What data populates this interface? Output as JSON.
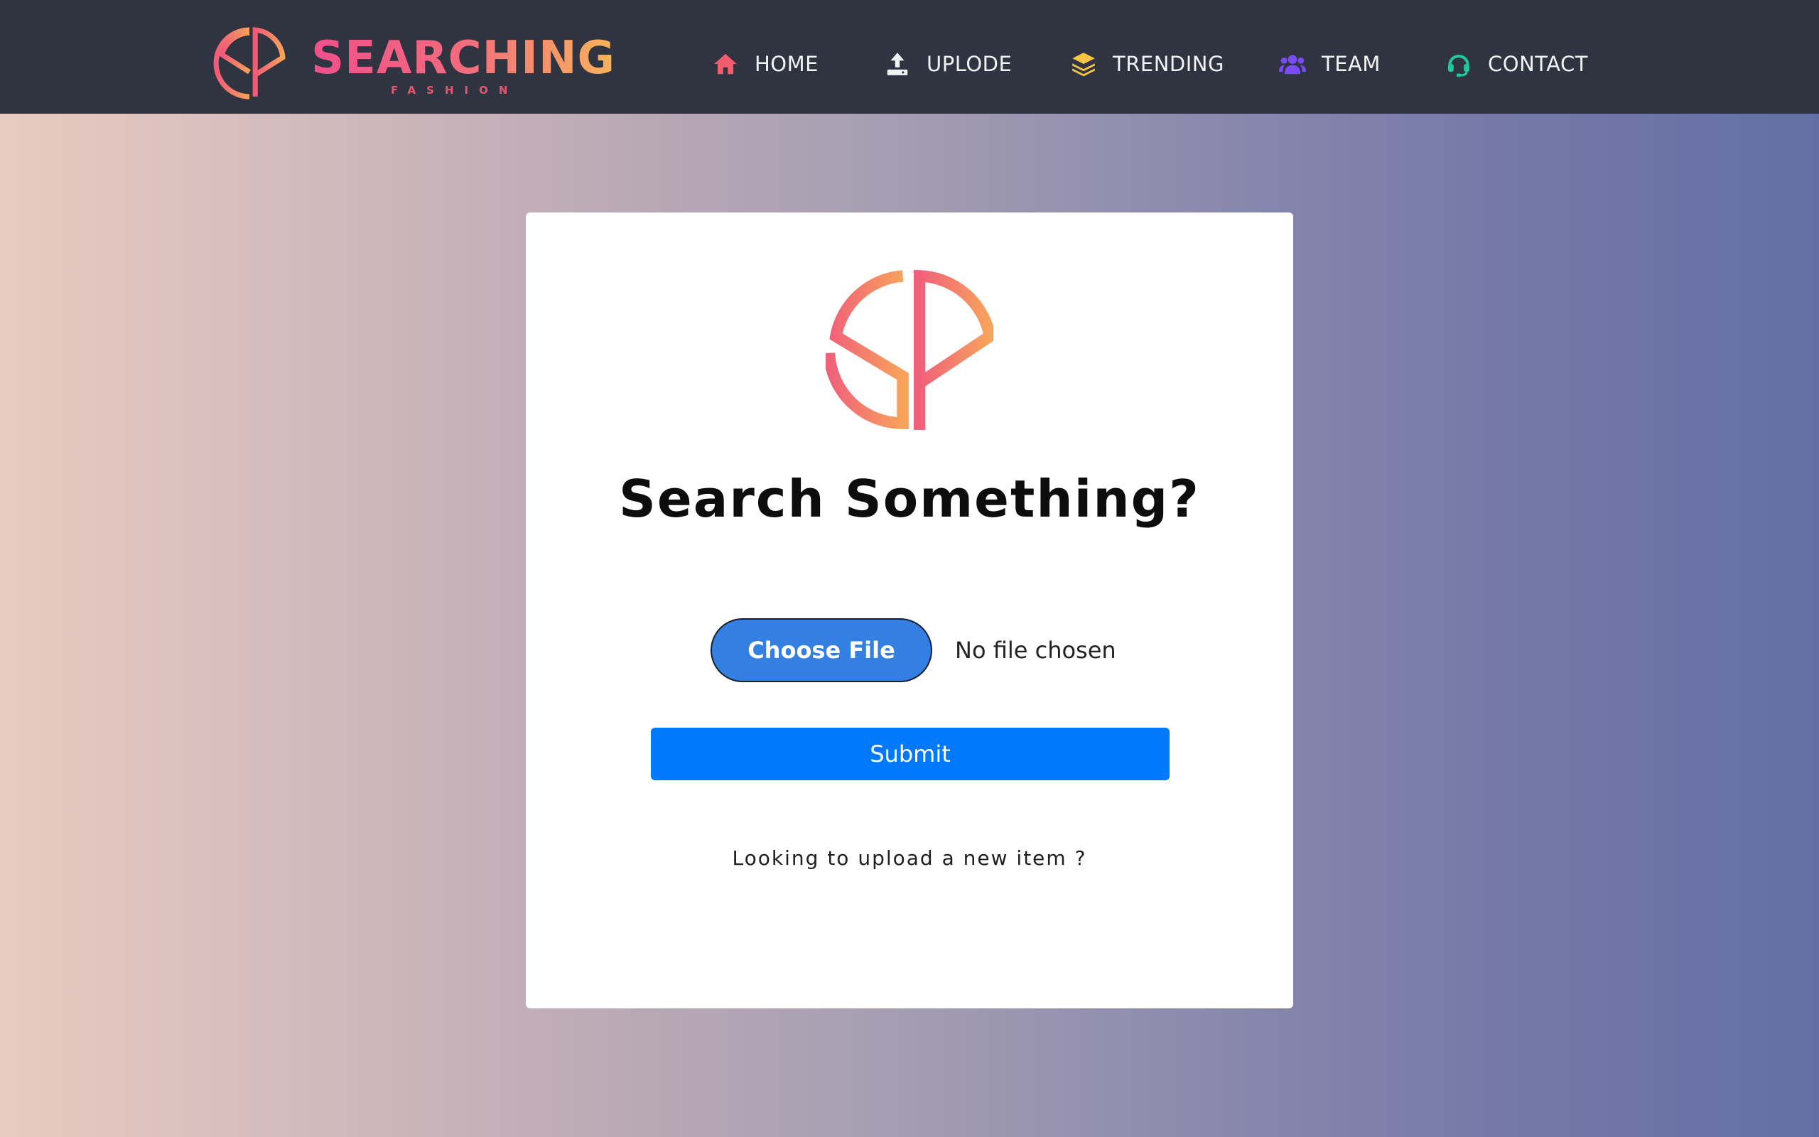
{
  "brand": {
    "name": "SEARCHING",
    "tagline": "FASHION",
    "logo_icon": "sf-monogram-icon"
  },
  "nav": {
    "items": [
      {
        "label": "HOME",
        "icon": "home-icon",
        "icon_color": "#f25c6e"
      },
      {
        "label": "UPLODE",
        "icon": "upload-icon",
        "icon_color": "#f1f2f4"
      },
      {
        "label": "TRENDING",
        "icon": "layers-icon",
        "icon_color": "#f6c542"
      },
      {
        "label": "TEAM",
        "icon": "users-icon",
        "icon_color": "#7a4cf5"
      },
      {
        "label": "CONTACT",
        "icon": "headset-icon",
        "icon_color": "#1fc79a"
      }
    ]
  },
  "card": {
    "title": "Search Something?",
    "choose_file_label": "Choose File",
    "file_status": "No file chosen",
    "submit_label": "Submit",
    "upload_prompt": "Looking to upload a new item ?"
  },
  "colors": {
    "navbar_bg": "#2f3440",
    "brand_gradient_start": "#f0508a",
    "brand_gradient_end": "#f8b45a",
    "submit_bg": "#0079fd",
    "choose_bg": "#3380e2"
  }
}
